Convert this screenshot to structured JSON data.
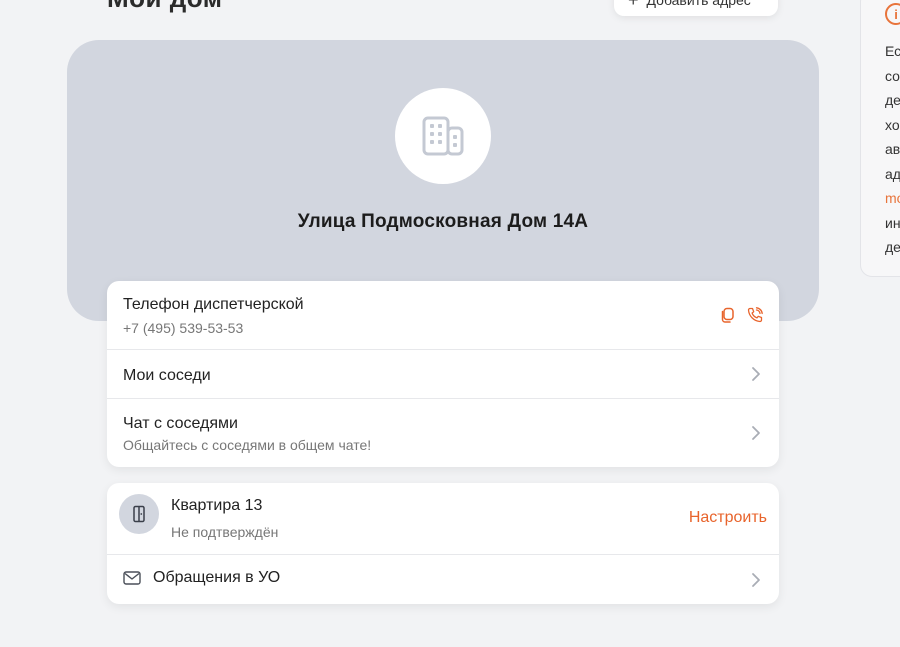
{
  "header": {
    "title": "Мой дом",
    "add_address_label": "Добавить адрес"
  },
  "info_panel": {
    "lines": [
      "Ес",
      "со",
      "де",
      "хо",
      "ав",
      "ад",
      "mo",
      "ин",
      "де"
    ]
  },
  "house": {
    "address": "Улица Подмосковная Дом 14А",
    "icon": "building-icon"
  },
  "main_list": {
    "phone": {
      "title": "Телефон диспетчерской",
      "number": "+7 (495) 539-53-53",
      "copy_icon": "copy-icon",
      "call_icon": "phone-call-icon"
    },
    "neighbors": {
      "title": "Мои соседи"
    },
    "chat": {
      "title": "Чат с соседями",
      "subtitle": "Общайтесь с соседями в общем чате!"
    }
  },
  "flat_card": {
    "flat": {
      "title": "Квартира 13",
      "status": "Не подтверждён",
      "action": "Настроить",
      "icon": "door-icon"
    },
    "appeals": {
      "title": "Обращения в УО",
      "icon": "mail-icon"
    }
  },
  "colors": {
    "accent": "#e8642c",
    "header_bg": "#d2d6df",
    "page_bg": "#f2f3f5"
  }
}
